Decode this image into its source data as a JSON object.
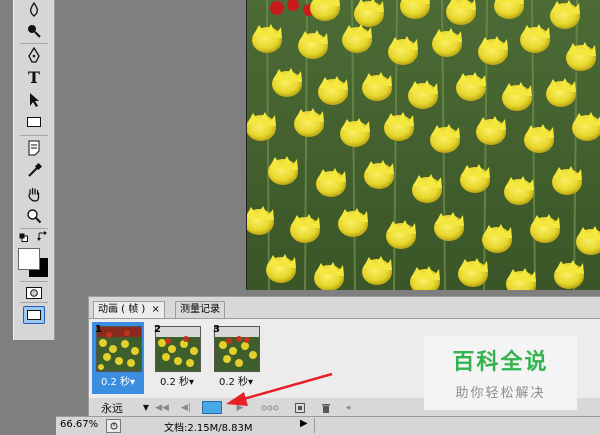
{
  "tabs": [
    {
      "label": "动画 ( 帧 )",
      "close": "×"
    },
    {
      "label": "测量记录"
    }
  ],
  "frames": [
    {
      "num": "1",
      "delay": "0.2 秒"
    },
    {
      "num": "2",
      "delay": "0.2 秒"
    },
    {
      "num": "3",
      "delay": "0.2 秒"
    }
  ],
  "loop": {
    "value": "永远"
  },
  "status": {
    "zoom": "66.67%",
    "doc": "文档:2.15M/8.83M"
  },
  "watermark": {
    "title": "百科全说",
    "subtitle": "助你轻松解决"
  },
  "colors": {
    "selected_frame": "#3b8de0",
    "arrow": "#e8202a",
    "watermark_green": "#2db24a"
  },
  "icons": [
    "droplet-icon",
    "burn-icon",
    "pen-icon",
    "type-icon",
    "path-select-icon",
    "rectangle-icon",
    "notes-icon",
    "eyedropper-icon",
    "hand-icon",
    "zoom-icon",
    "default-colors-icon",
    "swap-colors-icon",
    "quickmask-icon",
    "screenmode-icon"
  ]
}
